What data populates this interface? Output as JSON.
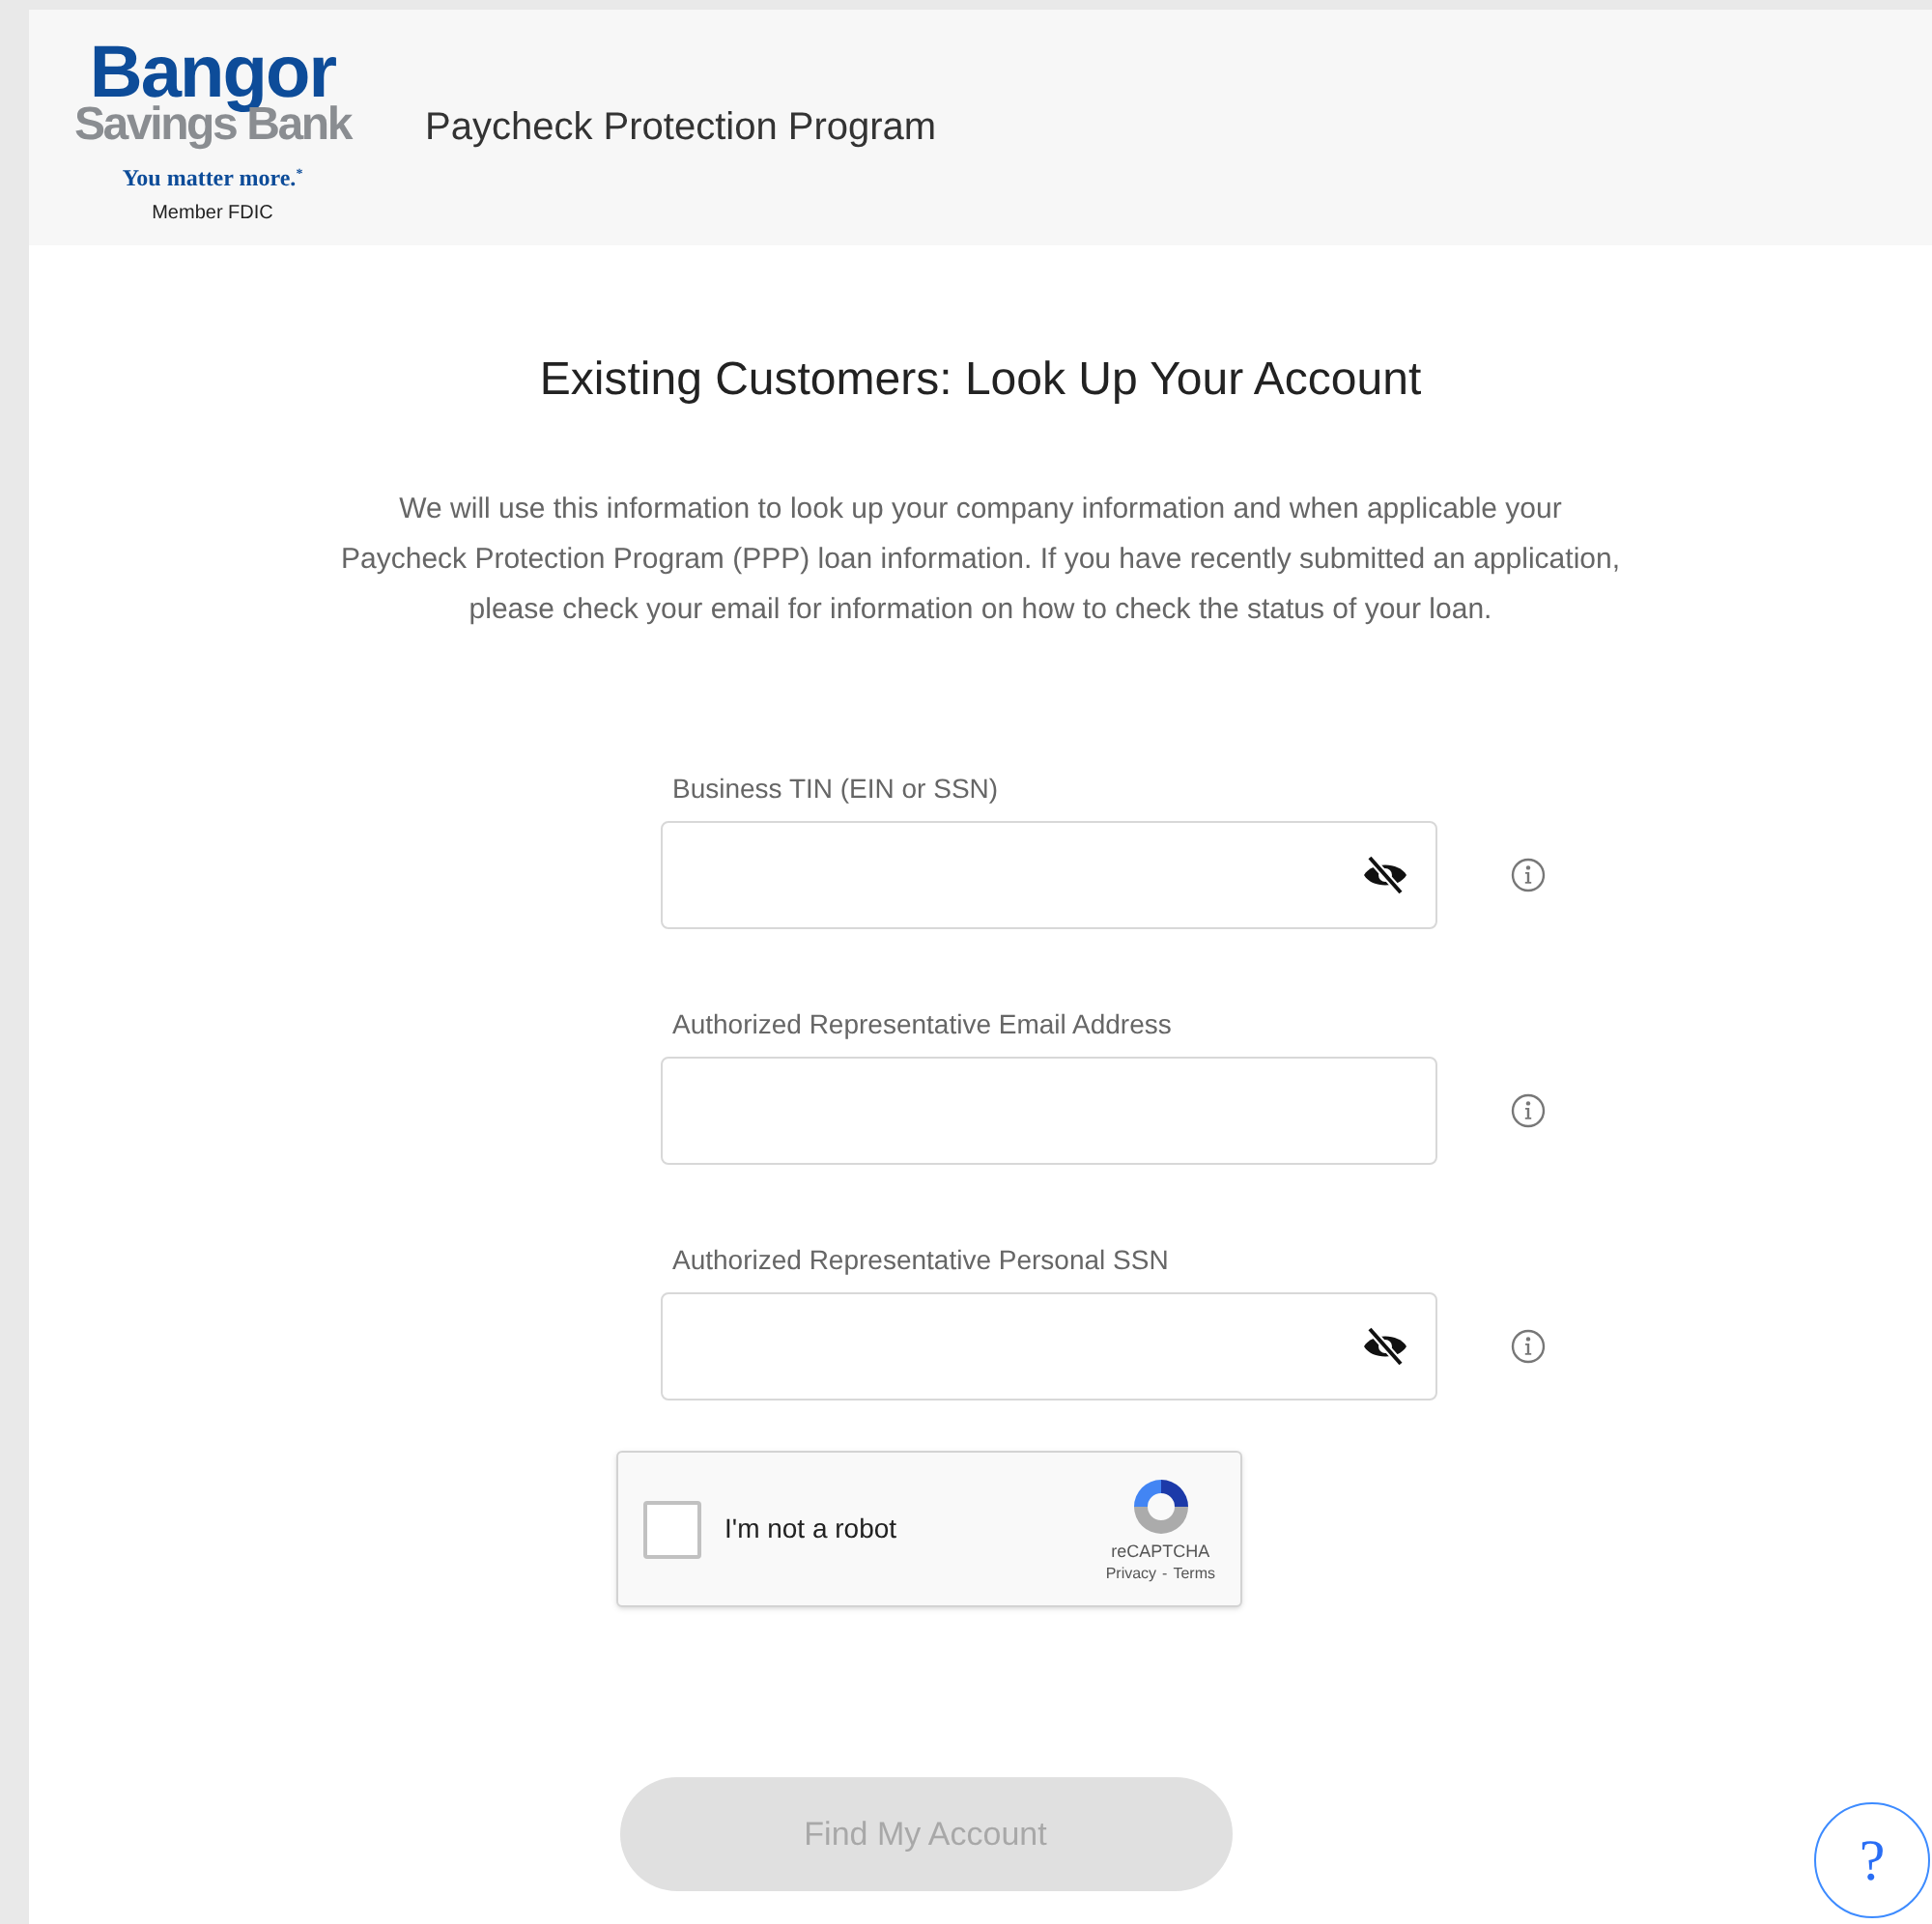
{
  "header": {
    "logo": {
      "name_top": "Bangor",
      "name_bottom": "Savings Bank",
      "tagline": "You matter more.",
      "tagline_mark": "*",
      "member": "Member FDIC"
    },
    "title": "Paycheck Protection Program"
  },
  "heading": "Existing Customers: Look Up Your Account",
  "intro": "We will use this information to look up your company information and when applicable your Paycheck Protection Program (PPP) loan information. If you have recently submitted an application, please check your email for information on how to check the status of your loan.",
  "fields": [
    {
      "label": "Business TIN (EIN or SSN)",
      "kind": "secret"
    },
    {
      "label": "Authorized Representative Email Address",
      "kind": "plain"
    },
    {
      "label": "Authorized Representative Personal SSN",
      "kind": "secret"
    }
  ],
  "captcha": {
    "label": "I'm not a robot",
    "checked": false,
    "brand": "reCAPTCHA",
    "privacy": "Privacy",
    "separator": "-",
    "terms": "Terms"
  },
  "submit": {
    "label": "Find My Account",
    "disabled": true
  },
  "help": {
    "label": "?"
  }
}
